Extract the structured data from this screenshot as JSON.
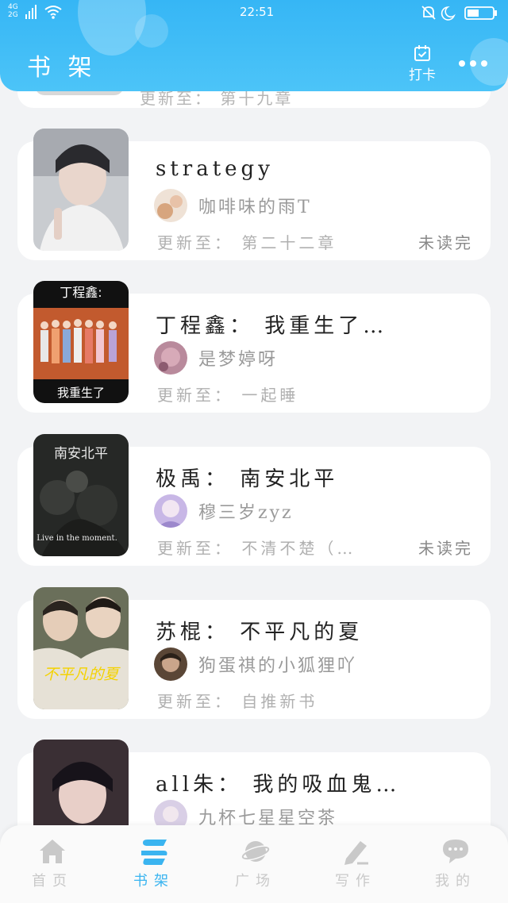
{
  "status_bar": {
    "signal_top": "4G",
    "signal_bottom": "2G",
    "time": "22:51"
  },
  "header": {
    "title": "书 架",
    "checkin_label": "打卡"
  },
  "peek": {
    "update_text": "更新至： 第十九章"
  },
  "books": [
    {
      "title": "strategy",
      "author": "咖啡味的雨T",
      "update": "更新至： 第二十二章",
      "status": "未读完"
    },
    {
      "title": "丁程鑫： 我重生了…",
      "author": "是梦婷呀",
      "update": "更新至： 一起睡",
      "status": "",
      "cover_text_top": "丁程鑫:",
      "cover_text_bottom": "我重生了"
    },
    {
      "title": "极禹： 南安北平",
      "author": "穆三岁zyz",
      "update": "更新至： 不清不楚（…",
      "status": "未读完",
      "cover_text_top": "南安北平",
      "cover_text_bottom": "Live in the moment."
    },
    {
      "title": "苏棍： 不平凡的夏",
      "author": "狗蛋祺的小狐狸吖",
      "update": "更新至： 自推新书",
      "status": "",
      "cover_text_bottom": "不平凡的夏"
    },
    {
      "title": "all朱： 我的吸血鬼…",
      "author": "九杯七星星空茶",
      "update": "",
      "status": ""
    }
  ],
  "nav": [
    {
      "label": "首页",
      "icon": "home-icon"
    },
    {
      "label": "书架",
      "icon": "bookshelf-icon"
    },
    {
      "label": "广场",
      "icon": "planet-icon"
    },
    {
      "label": "写作",
      "icon": "pen-icon"
    },
    {
      "label": "我的",
      "icon": "chat-bubble-icon"
    }
  ],
  "colors": {
    "accent": "#3ab4f0",
    "header": "#4cc4f8",
    "background": "#f2f3f5"
  }
}
